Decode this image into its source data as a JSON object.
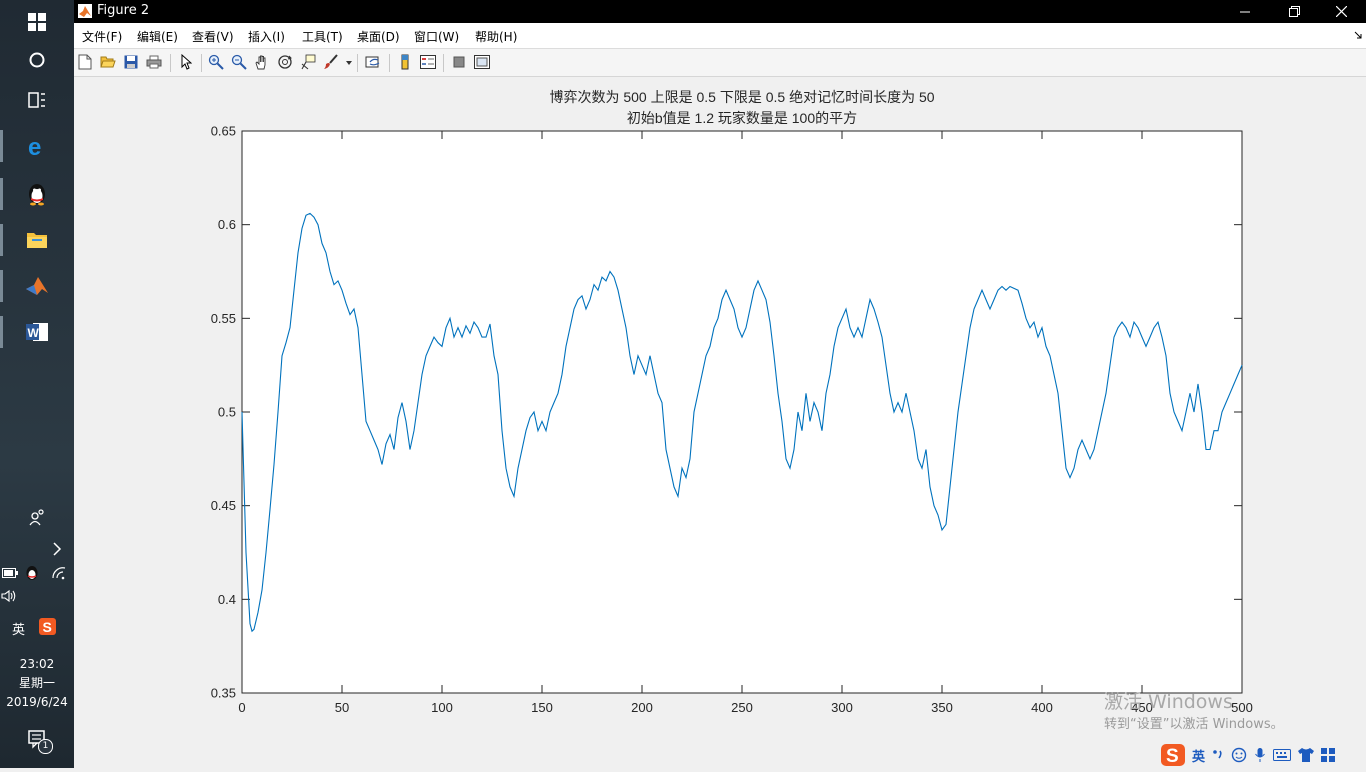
{
  "window": {
    "title": "Figure 2"
  },
  "menu": [
    "文件(F)",
    "编辑(E)",
    "查看(V)",
    "插入(I)",
    "工具(T)",
    "桌面(D)",
    "窗口(W)",
    "帮助(H)"
  ],
  "taskbar": {
    "time": "23:02",
    "weekday": "星期一",
    "date": "2019/6/24",
    "ime": "英",
    "notification_count": "1"
  },
  "watermark": {
    "line1": "激活 Windows",
    "line2": "转到“设置”以激活 Windows。"
  },
  "tray": {
    "ime": "英"
  },
  "chart_data": {
    "type": "line",
    "title_line1": "博弈次数为 500 上限是 0.5 下限是 0.5 绝对记忆时间长度为 50",
    "title_line2": "初始b值是 1.2 玩家数量是 100的平方",
    "xlim": [
      0,
      500
    ],
    "ylim": [
      0.35,
      0.65
    ],
    "xticks": [
      0,
      50,
      100,
      150,
      200,
      250,
      300,
      350,
      400,
      450,
      500
    ],
    "yticks": [
      0.35,
      0.4,
      0.45,
      0.5,
      0.55,
      0.6,
      0.65
    ],
    "xtick_labels": [
      "0",
      "50",
      "100",
      "150",
      "200",
      "250",
      "300",
      "350",
      "400",
      "450",
      "500"
    ],
    "ytick_labels": [
      "0.35",
      "0.4",
      "0.45",
      "0.5",
      "0.55",
      "0.6",
      "0.65"
    ],
    "grid": false,
    "color": "#0072bd",
    "x": [
      0,
      2,
      4,
      5,
      6,
      8,
      10,
      12,
      14,
      16,
      18,
      20,
      22,
      24,
      26,
      28,
      30,
      32,
      34,
      36,
      38,
      40,
      42,
      44,
      46,
      48,
      50,
      52,
      54,
      56,
      58,
      60,
      62,
      64,
      66,
      68,
      70,
      72,
      74,
      76,
      78,
      80,
      82,
      84,
      86,
      88,
      90,
      92,
      94,
      96,
      98,
      100,
      102,
      104,
      106,
      108,
      110,
      112,
      114,
      116,
      118,
      120,
      122,
      124,
      126,
      128,
      130,
      132,
      134,
      136,
      138,
      140,
      142,
      144,
      146,
      148,
      150,
      152,
      154,
      156,
      158,
      160,
      162,
      164,
      166,
      168,
      170,
      172,
      174,
      176,
      178,
      180,
      182,
      184,
      186,
      188,
      190,
      192,
      194,
      196,
      198,
      200,
      202,
      204,
      206,
      208,
      210,
      212,
      214,
      216,
      218,
      220,
      222,
      224,
      226,
      228,
      230,
      232,
      234,
      236,
      238,
      240,
      242,
      244,
      246,
      248,
      250,
      252,
      254,
      256,
      258,
      260,
      262,
      264,
      266,
      268,
      270,
      272,
      274,
      276,
      278,
      280,
      282,
      284,
      286,
      288,
      290,
      292,
      294,
      296,
      298,
      300,
      302,
      304,
      306,
      308,
      310,
      312,
      314,
      316,
      318,
      320,
      322,
      324,
      326,
      328,
      330,
      332,
      334,
      336,
      338,
      340,
      342,
      344,
      346,
      348,
      350,
      352,
      354,
      356,
      358,
      360,
      362,
      364,
      366,
      368,
      370,
      372,
      374,
      376,
      378,
      380,
      382,
      384,
      386,
      388,
      390,
      392,
      394,
      396,
      398,
      400,
      402,
      404,
      406,
      408,
      410,
      412,
      414,
      416,
      418,
      420,
      422,
      424,
      426,
      428,
      430,
      432,
      434,
      436,
      438,
      440,
      442,
      444,
      446,
      448,
      450,
      452,
      454,
      456,
      458,
      460,
      462,
      464,
      466,
      468,
      470,
      472,
      474,
      476,
      478,
      480,
      482,
      484,
      486,
      488,
      490,
      492,
      494,
      496,
      498,
      500
    ],
    "y": [
      0.5,
      0.425,
      0.387,
      0.383,
      0.384,
      0.393,
      0.405,
      0.425,
      0.448,
      0.472,
      0.5,
      0.53,
      0.537,
      0.545,
      0.565,
      0.585,
      0.598,
      0.605,
      0.606,
      0.604,
      0.6,
      0.59,
      0.585,
      0.575,
      0.568,
      0.57,
      0.565,
      0.558,
      0.552,
      0.555,
      0.545,
      0.52,
      0.495,
      0.49,
      0.485,
      0.48,
      0.472,
      0.483,
      0.488,
      0.48,
      0.497,
      0.505,
      0.495,
      0.48,
      0.49,
      0.505,
      0.52,
      0.53,
      0.535,
      0.54,
      0.537,
      0.535,
      0.545,
      0.55,
      0.54,
      0.545,
      0.54,
      0.546,
      0.542,
      0.548,
      0.545,
      0.54,
      0.54,
      0.547,
      0.53,
      0.52,
      0.49,
      0.47,
      0.46,
      0.455,
      0.47,
      0.48,
      0.49,
      0.497,
      0.5,
      0.49,
      0.495,
      0.49,
      0.5,
      0.505,
      0.51,
      0.52,
      0.535,
      0.545,
      0.555,
      0.56,
      0.562,
      0.555,
      0.56,
      0.568,
      0.565,
      0.572,
      0.57,
      0.575,
      0.572,
      0.565,
      0.555,
      0.545,
      0.53,
      0.52,
      0.53,
      0.525,
      0.52,
      0.53,
      0.52,
      0.51,
      0.505,
      0.48,
      0.47,
      0.46,
      0.455,
      0.47,
      0.465,
      0.475,
      0.5,
      0.51,
      0.52,
      0.53,
      0.535,
      0.545,
      0.55,
      0.56,
      0.565,
      0.56,
      0.555,
      0.545,
      0.54,
      0.545,
      0.555,
      0.565,
      0.57,
      0.565,
      0.56,
      0.548,
      0.53,
      0.51,
      0.495,
      0.475,
      0.47,
      0.48,
      0.5,
      0.49,
      0.51,
      0.495,
      0.505,
      0.5,
      0.49,
      0.51,
      0.52,
      0.535,
      0.545,
      0.55,
      0.555,
      0.545,
      0.54,
      0.545,
      0.54,
      0.55,
      0.56,
      0.555,
      0.548,
      0.54,
      0.525,
      0.51,
      0.5,
      0.505,
      0.5,
      0.51,
      0.5,
      0.49,
      0.475,
      0.47,
      0.48,
      0.46,
      0.45,
      0.445,
      0.437,
      0.44,
      0.46,
      0.48,
      0.5,
      0.515,
      0.53,
      0.545,
      0.555,
      0.56,
      0.565,
      0.56,
      0.555,
      0.56,
      0.565,
      0.567,
      0.565,
      0.567,
      0.566,
      0.565,
      0.558,
      0.55,
      0.545,
      0.548,
      0.54,
      0.545,
      0.535,
      0.53,
      0.52,
      0.51,
      0.49,
      0.47,
      0.465,
      0.47,
      0.48,
      0.485,
      0.48,
      0.475,
      0.48,
      0.49,
      0.5,
      0.51,
      0.525,
      0.54,
      0.545,
      0.548,
      0.545,
      0.54,
      0.548,
      0.545,
      0.54,
      0.535,
      0.54,
      0.545,
      0.548,
      0.54,
      0.53,
      0.51,
      0.5,
      0.495,
      0.49,
      0.5,
      0.51,
      0.5,
      0.515,
      0.5,
      0.48,
      0.48,
      0.49,
      0.49,
      0.5,
      0.505,
      0.51,
      0.515,
      0.52,
      0.525,
      0.52,
      0.525
    ]
  }
}
